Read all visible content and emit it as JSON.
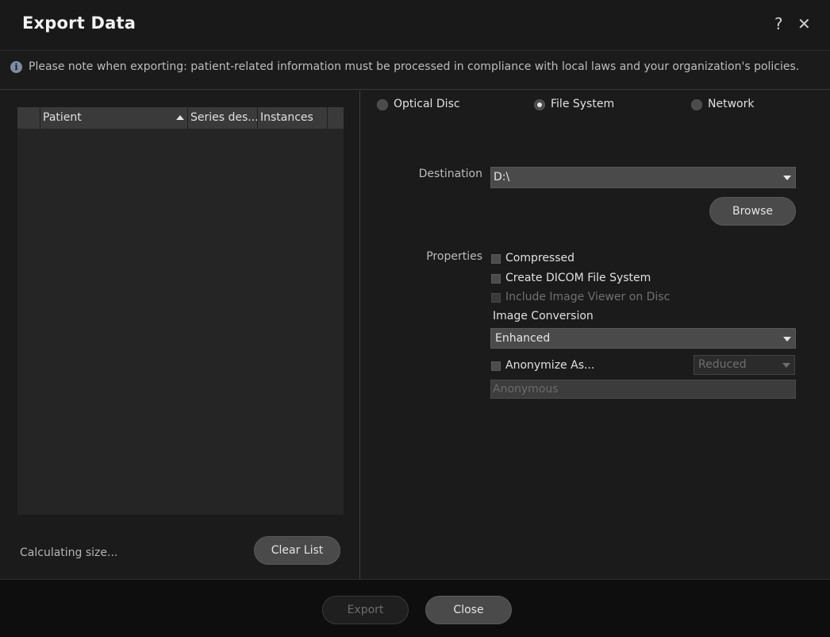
{
  "window": {
    "title": "Export Data",
    "help_glyph": "?",
    "close_glyph": "✕"
  },
  "notice": {
    "icon": "info-icon",
    "icon_glyph": "i",
    "text": "Please note when exporting: patient-related information must be processed in compliance with local laws and your organization's policies."
  },
  "table": {
    "columns": [
      "Patient",
      "Series des...",
      "Instances"
    ],
    "sort_column": "Patient",
    "sort_direction": "ascending",
    "rows": []
  },
  "left_footer": {
    "status": "Calculating size...",
    "clear_label": "Clear List"
  },
  "media": {
    "options": [
      "Optical Disc",
      "File System",
      "Network"
    ],
    "selected": "File System"
  },
  "destination": {
    "label": "Destination",
    "value": "D:\\",
    "browse_label": "Browse"
  },
  "properties": {
    "label": "Properties",
    "compressed": {
      "label": "Compressed",
      "checked": false,
      "enabled": true
    },
    "create_dicom_fs": {
      "label": "Create DICOM File System",
      "checked": false,
      "enabled": true
    },
    "include_viewer": {
      "label": "Include Image Viewer on Disc",
      "checked": false,
      "enabled": false
    },
    "image_conversion_label": "Image Conversion",
    "image_conversion_value": "Enhanced",
    "anonymize": {
      "label": "Anonymize As...",
      "checked": false,
      "enabled": true
    },
    "anonymize_mode": "Reduced",
    "anonymize_name_placeholder": "Anonymous"
  },
  "footer": {
    "export_label": "Export",
    "close_label": "Close"
  },
  "colors": {
    "background": "#1b1b1b",
    "header_bg": "#3a3a3a",
    "button_bg": "#4a4a4a",
    "text": "#e0e0e0",
    "disabled_text": "#6d6d6d"
  }
}
